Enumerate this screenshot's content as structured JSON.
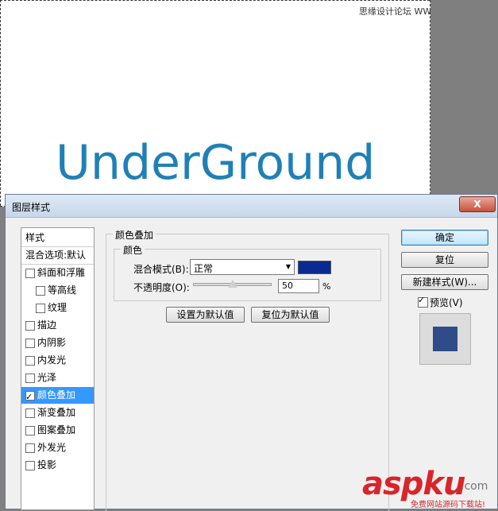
{
  "watermark_top": "思缘设计论坛 WWW.MISSYUAN.COM",
  "canvas": {
    "text": "UnderGround"
  },
  "dialog": {
    "title": "图层样式",
    "close": "X",
    "styles_list": [
      {
        "label": "样式",
        "checkbox": false,
        "checked": false,
        "indent": false,
        "selected": false
      },
      {
        "label": "混合选项:默认",
        "checkbox": false,
        "checked": false,
        "indent": false,
        "selected": false
      },
      {
        "label": "斜面和浮雕",
        "checkbox": true,
        "checked": false,
        "indent": false,
        "selected": false
      },
      {
        "label": "等高线",
        "checkbox": true,
        "checked": false,
        "indent": true,
        "selected": false
      },
      {
        "label": "纹理",
        "checkbox": true,
        "checked": false,
        "indent": true,
        "selected": false
      },
      {
        "label": "描边",
        "checkbox": true,
        "checked": false,
        "indent": false,
        "selected": false
      },
      {
        "label": "内阴影",
        "checkbox": true,
        "checked": false,
        "indent": false,
        "selected": false
      },
      {
        "label": "内发光",
        "checkbox": true,
        "checked": false,
        "indent": false,
        "selected": false
      },
      {
        "label": "光泽",
        "checkbox": true,
        "checked": false,
        "indent": false,
        "selected": false
      },
      {
        "label": "颜色叠加",
        "checkbox": true,
        "checked": true,
        "indent": false,
        "selected": true
      },
      {
        "label": "渐变叠加",
        "checkbox": true,
        "checked": false,
        "indent": false,
        "selected": false
      },
      {
        "label": "图案叠加",
        "checkbox": true,
        "checked": false,
        "indent": false,
        "selected": false
      },
      {
        "label": "外发光",
        "checkbox": true,
        "checked": false,
        "indent": false,
        "selected": false
      },
      {
        "label": "投影",
        "checkbox": true,
        "checked": false,
        "indent": false,
        "selected": false
      }
    ],
    "panel": {
      "group_title": "颜色叠加",
      "sub_group_title": "颜色",
      "blend_mode_label": "混合模式(B):",
      "blend_mode_value": "正常",
      "overlay_color": "#0a2a8f",
      "opacity_label": "不透明度(O):",
      "opacity_value": "50",
      "opacity_unit": "%",
      "set_default_button": "设置为默认值",
      "reset_default_button": "复位为默认值"
    },
    "buttons": {
      "ok": "确定",
      "reset": "复位",
      "new_style": "新建样式(W)...",
      "preview_label": "预览(V)",
      "preview_checked": true
    },
    "preview_color": "#2f4c88"
  },
  "watermark_bottom": {
    "brand": "aspku",
    "suffix": ".com",
    "tagline": "免费网站源码下载站!"
  }
}
